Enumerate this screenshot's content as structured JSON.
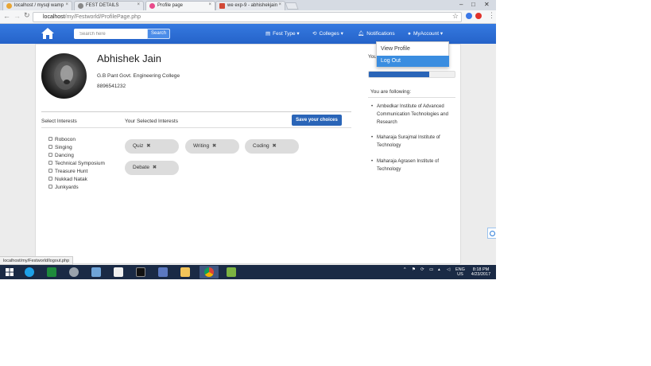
{
  "browser": {
    "tabs": [
      {
        "label": "localhost / mysql wamp",
        "favicon_color": "#e8a534",
        "active": false
      },
      {
        "label": "FEST DETAILS",
        "favicon_color": "#888888",
        "active": false
      },
      {
        "label": "Profile page",
        "favicon_color": "#e94b8b",
        "active": true
      },
      {
        "label": "we exp-9 - abhishekjain",
        "favicon_color": "#d14836",
        "active": false
      }
    ],
    "url_host": "localhost",
    "url_path": "/my/Festworld/ProfilePage.php",
    "status_url": "localhost/my/Festworld/logout.php"
  },
  "nav": {
    "search_placeholder": "Search here",
    "search_button": "Search",
    "fest_type": "Fest Type",
    "colleges": "Colleges",
    "notifications": "Notifications",
    "my_account": "MyAccount"
  },
  "account_menu": {
    "items": [
      "View Profile",
      "Log Out"
    ]
  },
  "profile": {
    "name": "Abhishek Jain",
    "college": "G.B Pant Govt. Engineering College",
    "phone": "8896541232"
  },
  "interests": {
    "select_title": "Select Interests",
    "selected_title": "Your Selected Interests",
    "save_button": "Save your choices",
    "options": [
      "Robocon",
      "Singing",
      "Dancing",
      "Technical Symposium",
      "Treasure Hunt",
      "Nukkad Natak",
      "Junkyards"
    ],
    "selected": [
      "Quiz",
      "Writing",
      "Coding",
      "Debate"
    ]
  },
  "sidebar": {
    "you_label": "You",
    "progress_fraction": 0.7,
    "following_title": "You are following:",
    "following": [
      "Ambedkar Institute of Advanced Communication Technologies and Research",
      "Maharaja Surajmal Institute of Technology",
      "Maharaja Agrasen Institute of Technology"
    ]
  },
  "taskbar": {
    "language": "ENG",
    "region": "US",
    "time": "8:18 PM",
    "date": "4/23/2017"
  },
  "colors": {
    "nav_blue": "#2c6fd6",
    "button_blue": "#2a65b8",
    "menu_highlight": "#3a8de0"
  }
}
